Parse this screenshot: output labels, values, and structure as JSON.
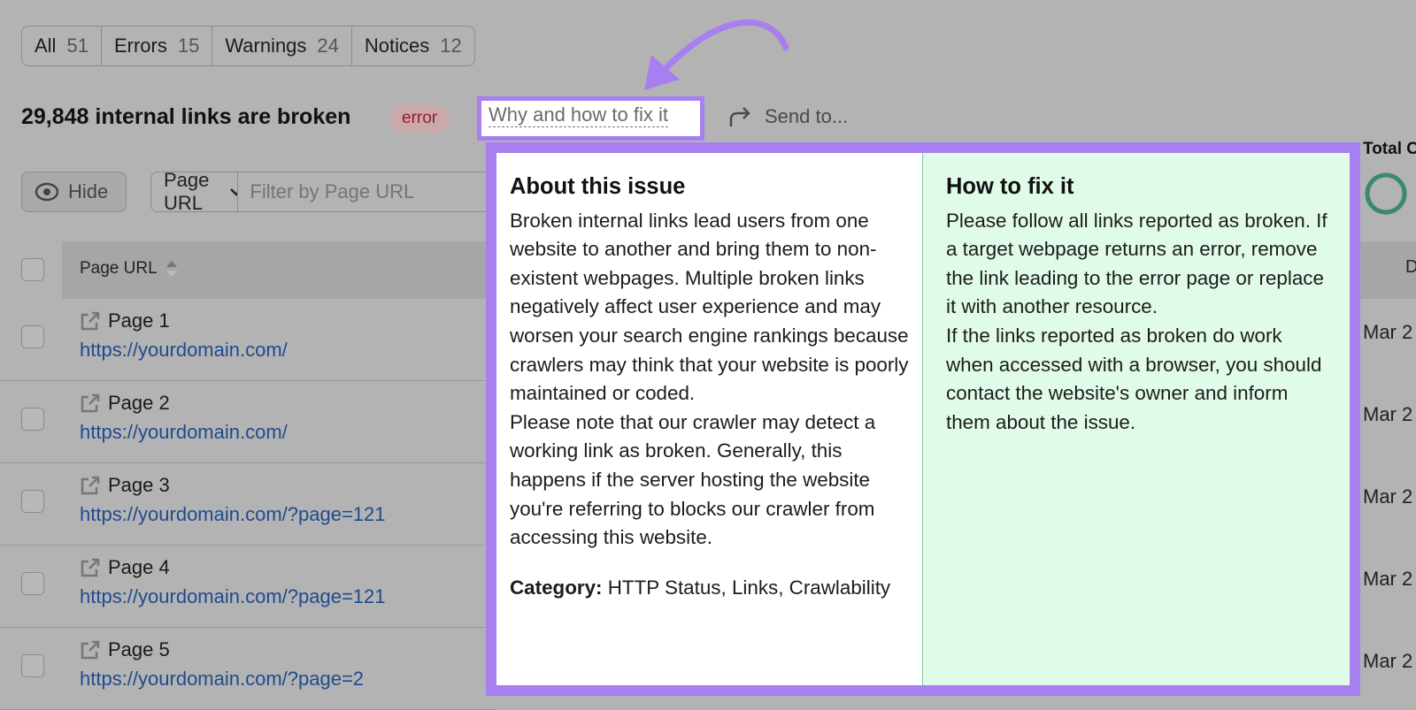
{
  "tabs": [
    {
      "label": "All",
      "count": "51"
    },
    {
      "label": "Errors",
      "count": "15"
    },
    {
      "label": "Warnings",
      "count": "24"
    },
    {
      "label": "Notices",
      "count": "12"
    }
  ],
  "issue": {
    "title": "29,848 internal links are broken",
    "badge": "error",
    "why_link": "Why and how to fix it",
    "send_to": "Send to..."
  },
  "toolbar": {
    "hide": "Hide",
    "column_select": "Page URL",
    "filter_placeholder": "Filter by Page URL"
  },
  "table": {
    "header_page_url": "Page URL",
    "header_right": "D",
    "rows": [
      {
        "label": "Page 1",
        "url": "https://yourdomain.com/",
        "date": "Mar 2"
      },
      {
        "label": "Page 2",
        "url": "https://yourdomain.com/",
        "date": "Mar 2"
      },
      {
        "label": "Page 3",
        "url": "https://yourdomain.com/?page=121",
        "date": "Mar 2"
      },
      {
        "label": "Page 4",
        "url": "https://yourdomain.com/?page=121",
        "date": "Mar 2"
      },
      {
        "label": "Page 5",
        "url": "https://yourdomain.com/?page=2",
        "date": "Mar 2"
      }
    ]
  },
  "total_label": "Total C",
  "popup": {
    "about_title": "About this issue",
    "about_p1": "Broken internal links lead users from one website to another and bring them to non-existent webpages. Multiple broken links negatively affect user experience and may worsen your search engine rankings because crawlers may think that your website is poorly maintained or coded.",
    "about_p2": "Please note that our crawler may detect a working link as broken. Generally, this happens if the server hosting the website you're referring to blocks our crawler from accessing this website.",
    "category_label": "Category:",
    "category_value": "HTTP Status, Links, Crawlability",
    "fix_title": "How to fix it",
    "fix_p1": "Please follow all links reported as broken. If a target webpage returns an error, remove the link leading to the error page or replace it with another resource.",
    "fix_p2": "If the links reported as broken do work when accessed with a browser, you should contact the website's owner and inform them about the issue."
  },
  "colors": {
    "highlight": "#a77ff1",
    "fix_bg": "#e1fbe9",
    "error_text": "#9a1a22",
    "link": "#1f4b8f"
  }
}
